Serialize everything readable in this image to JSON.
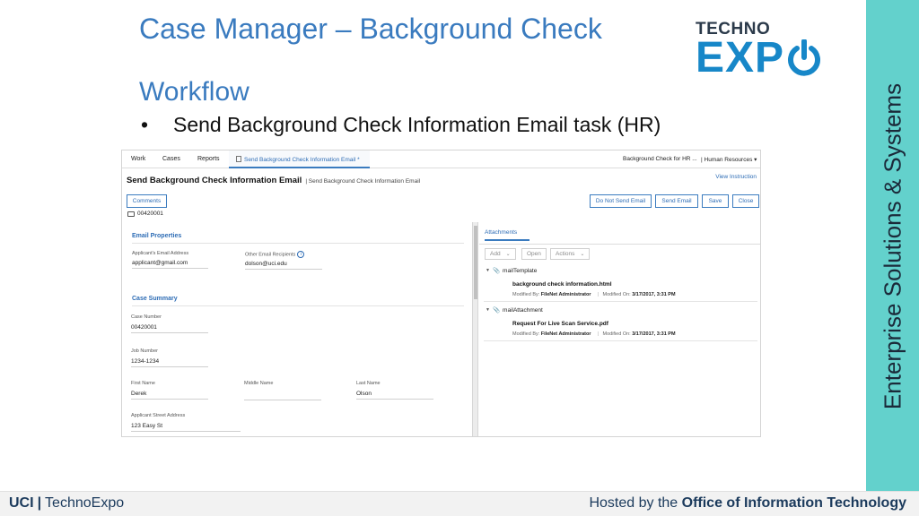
{
  "slide": {
    "title": "Case Manager – Background Check",
    "section": "Workflow",
    "bullet_marker": "•",
    "bullet": "Send Background Check Information Email task (HR)"
  },
  "logo": {
    "top": "TECHNO",
    "bottom": "EXP"
  },
  "side_banner": "Enterprise Solutions & Systems",
  "footer": {
    "left_brand": "UCI",
    "left_sep": "|",
    "left_name": "TechnoExpo",
    "right_prefix": "Hosted by the ",
    "right_strong": "Office of Information Technology"
  },
  "app": {
    "nav": {
      "work": "Work",
      "cases": "Cases",
      "reports": "Reports",
      "active_tab": "Send Background Check Information Email *",
      "right_case": "Background Check for HR ...",
      "right_role": "| Human Resources"
    },
    "header": {
      "title": "Send Background Check Information Email",
      "subtitle": "| Send Background Check Information Email",
      "view_instructions": "View Instruction"
    },
    "buttons": {
      "comments": "Comments",
      "do_not_send": "Do Not Send Email",
      "send": "Send Email",
      "save": "Save",
      "close": "Close"
    },
    "case_id": "00420001",
    "email_properties": {
      "heading": "Email Properties",
      "applicant_email_label": "Applicant's Email Address",
      "applicant_email_value": "applicant@gmail.com",
      "other_recipients_label": "Other Email Recipients",
      "other_recipients_value": "dolson@uci.edu"
    },
    "case_summary": {
      "heading": "Case Summary",
      "case_number_label": "Case Number",
      "case_number_value": "00420001",
      "job_number_label": "Job Number",
      "job_number_value": "1234-1234",
      "first_name_label": "First Name",
      "first_name_value": "Derek",
      "middle_name_label": "Middle Name",
      "middle_name_value": "",
      "last_name_label": "Last Name",
      "last_name_value": "Olson",
      "street_label": "Applicant Street Address",
      "street_value": "123 Easy St"
    },
    "attachments": {
      "tab": "Attachments",
      "add": "Add",
      "open": "Open",
      "actions": "Actions",
      "groups": [
        {
          "name": "mailTemplate",
          "doc": "background check information.html",
          "modified_by_label": "Modified By:",
          "modified_by": "FileNet Administrator",
          "modified_on_label": "Modified On:",
          "modified_on": "3/17/2017, 3:31 PM"
        },
        {
          "name": "mailAttachment",
          "doc": "Request For Live Scan Service.pdf",
          "modified_by_label": "Modified By:",
          "modified_by": "FileNet Administrator",
          "modified_on_label": "Modified On:",
          "modified_on": "3/17/2017, 3:31 PM"
        }
      ]
    }
  },
  "colors": {
    "title_blue": "#3a7bbf",
    "banner_teal": "#63d1cc",
    "logo_blue": "#1787c8",
    "link_blue": "#2d6cb5"
  }
}
